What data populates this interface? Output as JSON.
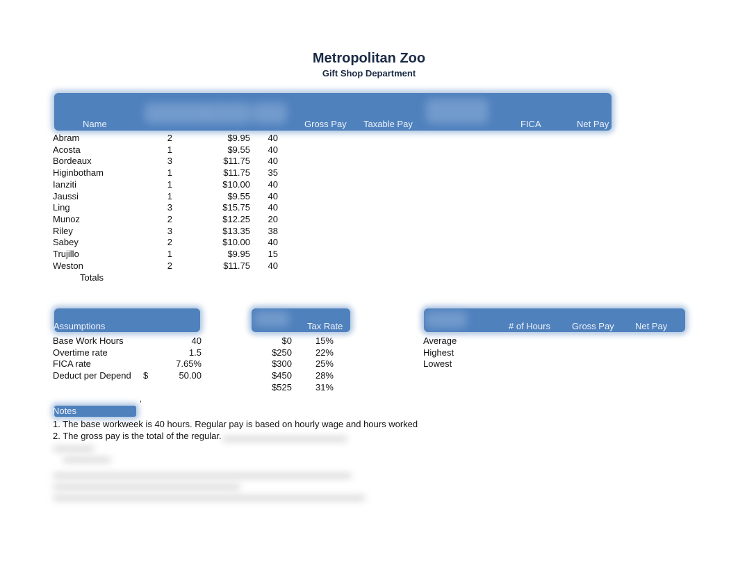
{
  "title": "Metropolitan Zoo",
  "subtitle": "Gift Shop Department",
  "payroll": {
    "headers": {
      "name": "Name",
      "gross_pay": "Gross Pay",
      "taxable_pay": "Taxable Pay",
      "fica": "FICA",
      "net_pay": "Net Pay"
    },
    "rows": [
      {
        "name": "Abram",
        "dependents": "2",
        "rate": "$9.95",
        "hours": "40"
      },
      {
        "name": "Acosta",
        "dependents": "1",
        "rate": "$9.55",
        "hours": "40"
      },
      {
        "name": "Bordeaux",
        "dependents": "3",
        "rate": "$11.75",
        "hours": "40"
      },
      {
        "name": "Higinbotham",
        "dependents": "1",
        "rate": "$11.75",
        "hours": "35"
      },
      {
        "name": "Ianziti",
        "dependents": "1",
        "rate": "$10.00",
        "hours": "40"
      },
      {
        "name": "Jaussi",
        "dependents": "1",
        "rate": "$9.55",
        "hours": "40"
      },
      {
        "name": "Ling",
        "dependents": "3",
        "rate": "$15.75",
        "hours": "40"
      },
      {
        "name": "Munoz",
        "dependents": "2",
        "rate": "$12.25",
        "hours": "20"
      },
      {
        "name": "Riley",
        "dependents": "3",
        "rate": "$13.35",
        "hours": "38"
      },
      {
        "name": "Sabey",
        "dependents": "2",
        "rate": "$10.00",
        "hours": "40"
      },
      {
        "name": "Trujillo",
        "dependents": "1",
        "rate": "$9.95",
        "hours": "15"
      },
      {
        "name": "Weston",
        "dependents": "2",
        "rate": "$11.75",
        "hours": "40"
      }
    ],
    "totals_label": "Totals"
  },
  "assumptions": {
    "header": "Assumptions",
    "items": [
      {
        "label": "Base Work Hours",
        "prefix": "",
        "value": "40"
      },
      {
        "label": "Overtime rate",
        "prefix": "",
        "value": "1.5"
      },
      {
        "label": "FICA rate",
        "prefix": "",
        "value": "7.65%"
      },
      {
        "label": "Deduct per Depend",
        "prefix": "$",
        "value": "50.00"
      }
    ]
  },
  "tax_table": {
    "header": "Tax Rate",
    "rows": [
      {
        "threshold": "$0",
        "rate": "15%"
      },
      {
        "threshold": "$250",
        "rate": "22%"
      },
      {
        "threshold": "$300",
        "rate": "25%"
      },
      {
        "threshold": "$450",
        "rate": "28%"
      },
      {
        "threshold": "$525",
        "rate": "31%"
      }
    ]
  },
  "stats": {
    "headers": {
      "hours": "# of Hours",
      "gross_pay": "Gross Pay",
      "net_pay": "Net Pay"
    },
    "rows": [
      "Average",
      "Highest",
      "Lowest"
    ]
  },
  "notes": {
    "header": "Notes",
    "lines": [
      "1. The base workweek is 40 hours. Regular pay is based on hourly wage and hours worked",
      "2. The gross pay is the total of the regular."
    ]
  }
}
